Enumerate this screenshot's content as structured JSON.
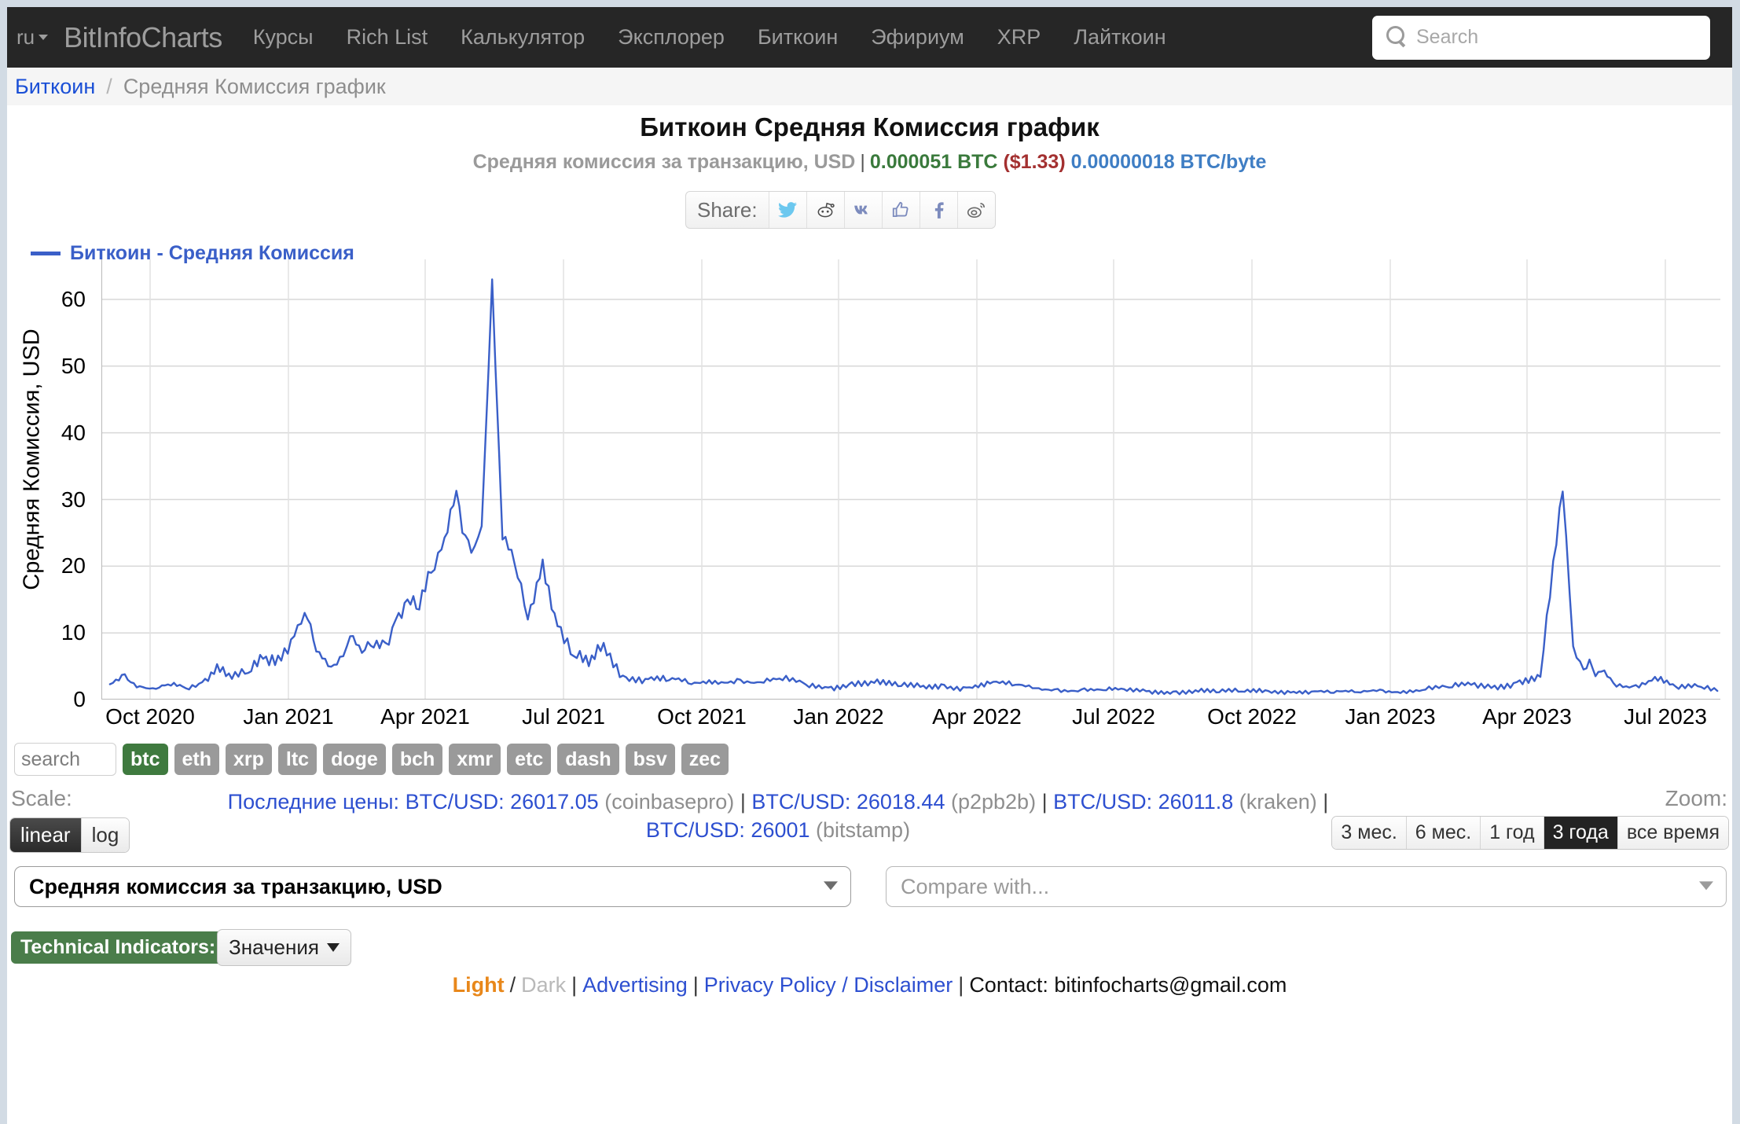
{
  "navbar": {
    "lang": "ru",
    "brand": "BitInfoCharts",
    "links": [
      "Курсы",
      "Rich List",
      "Калькулятор",
      "Эксплорер",
      "Биткоин",
      "Эфириум",
      "XRP",
      "Лайткоин"
    ],
    "search_placeholder": "Search",
    "search_value": "",
    "search_icon": "search-icon",
    "bg": "#262626",
    "text_color": "#9d9d9d"
  },
  "breadcrumb": {
    "root": "Биткоин",
    "separator": "/",
    "current": "Средняя Комиссия график"
  },
  "header": {
    "title": "Биткоин Средняя Комиссия график",
    "subtitle_gray": "Средняя комиссия за транзакцию, USD",
    "subtitle_pipe": "|",
    "subtitle_btc": "0.000051 BTC",
    "subtitle_usd": "($1.33)",
    "subtitle_perbyte": "0.00000018 BTC/byte",
    "color_green": "#3a7a3c",
    "color_red": "#a33030",
    "color_blue": "#3f7ec4"
  },
  "share": {
    "label": "Share:",
    "buttons": [
      "twitter-icon",
      "reddit-icon",
      "vk-icon",
      "thumbs-up-icon",
      "facebook-icon",
      "weibo-icon"
    ]
  },
  "chart_data": {
    "type": "line",
    "title": "Биткоин Средняя Комиссия график",
    "legend": [
      "Биткоин - Средняя Комиссия"
    ],
    "legend_position": "top-left",
    "xlabel": "",
    "ylabel": "Средняя Комиссия, USD",
    "ylim": [
      0,
      66
    ],
    "yticks": [
      0,
      10,
      20,
      30,
      40,
      50,
      60
    ],
    "grid": true,
    "line_color": "#3a5fc8",
    "xticks": [
      "Oct 2020",
      "Jan 2021",
      "Apr 2021",
      "Jul 2021",
      "Oct 2021",
      "Jan 2022",
      "Apr 2022",
      "Jul 2022",
      "Oct 2022",
      "Jan 2023",
      "Apr 2023",
      "Jul 2023"
    ],
    "xlim": [
      "Sep 2020",
      "Aug 2023"
    ],
    "series": [
      {
        "name": "Биткоин - Средняя Комиссия",
        "x": [
          "2020-09-05",
          "2020-09-15",
          "2020-09-25",
          "2020-10-05",
          "2020-10-15",
          "2020-10-25",
          "2020-11-05",
          "2020-11-15",
          "2020-11-25",
          "2020-12-05",
          "2020-12-15",
          "2020-12-25",
          "2021-01-05",
          "2021-01-12",
          "2021-01-20",
          "2021-01-28",
          "2021-02-05",
          "2021-02-12",
          "2021-02-20",
          "2021-02-28",
          "2021-03-05",
          "2021-03-12",
          "2021-03-20",
          "2021-03-28",
          "2021-04-05",
          "2021-04-12",
          "2021-04-18",
          "2021-04-22",
          "2021-04-26",
          "2021-05-01",
          "2021-05-08",
          "2021-05-15",
          "2021-05-22",
          "2021-05-30",
          "2021-06-08",
          "2021-06-18",
          "2021-06-28",
          "2021-07-08",
          "2021-07-18",
          "2021-07-28",
          "2021-08-10",
          "2021-08-25",
          "2021-09-10",
          "2021-09-25",
          "2021-10-10",
          "2021-10-25",
          "2021-11-10",
          "2021-11-25",
          "2021-12-10",
          "2021-12-25",
          "2022-01-10",
          "2022-01-25",
          "2022-02-10",
          "2022-02-25",
          "2022-03-10",
          "2022-03-25",
          "2022-04-10",
          "2022-04-25",
          "2022-05-10",
          "2022-05-25",
          "2022-06-10",
          "2022-06-25",
          "2022-07-10",
          "2022-07-25",
          "2022-08-10",
          "2022-08-25",
          "2022-09-10",
          "2022-09-25",
          "2022-10-10",
          "2022-10-25",
          "2022-11-10",
          "2022-11-25",
          "2022-12-10",
          "2022-12-25",
          "2023-01-10",
          "2023-01-25",
          "2023-02-10",
          "2023-02-25",
          "2023-03-10",
          "2023-03-25",
          "2023-04-10",
          "2023-04-25",
          "2023-05-01",
          "2023-05-08",
          "2023-05-12",
          "2023-05-16",
          "2023-05-20",
          "2023-05-28",
          "2023-06-10",
          "2023-06-25",
          "2023-07-10",
          "2023-07-25",
          "2023-08-05"
        ],
        "y": [
          2.3,
          3.8,
          2.0,
          1.6,
          2.1,
          1.7,
          2.6,
          5.3,
          3.1,
          4.0,
          6.1,
          6.6,
          9.5,
          13.0,
          7.2,
          5.0,
          6.4,
          9.5,
          7.0,
          7.8,
          8.5,
          12.0,
          15.0,
          13.5,
          19.0,
          22.5,
          28.5,
          31.3,
          25.0,
          22.0,
          26.0,
          63.0,
          24.0,
          20.5,
          12.0,
          21.0,
          11.0,
          6.5,
          5.0,
          8.5,
          3.6,
          3.1,
          2.9,
          2.3,
          2.8,
          3.1,
          2.6,
          2.9,
          2.2,
          1.8,
          2.6,
          2.5,
          2.0,
          1.9,
          2.2,
          1.8,
          2.4,
          2.1,
          1.7,
          1.6,
          1.5,
          1.4,
          1.3,
          1.3,
          1.2,
          1.4,
          1.1,
          1.2,
          1.4,
          1.3,
          1.2,
          1.0,
          1.1,
          1.5,
          1.3,
          1.5,
          1.8,
          2.2,
          2.1,
          2.6,
          3.4,
          31.2,
          8.0,
          4.5,
          6.0,
          3.5,
          4.2,
          2.5,
          2.0,
          3.4,
          1.6,
          1.9,
          1.3
        ]
      }
    ],
    "peaks": [
      {
        "label": "Apr 2021 peak",
        "value": 63.0
      },
      {
        "label": "Apr 2023 peak",
        "value": 31.2
      }
    ]
  },
  "coin_row": {
    "search_placeholder": "search",
    "search_value": "",
    "tags": [
      {
        "label": "btc",
        "active": true
      },
      {
        "label": "eth",
        "active": false
      },
      {
        "label": "xrp",
        "active": false
      },
      {
        "label": "ltc",
        "active": false
      },
      {
        "label": "doge",
        "active": false
      },
      {
        "label": "bch",
        "active": false
      },
      {
        "label": "xmr",
        "active": false
      },
      {
        "label": "etc",
        "active": false
      },
      {
        "label": "dash",
        "active": false
      },
      {
        "label": "bsv",
        "active": false
      },
      {
        "label": "zec",
        "active": false
      }
    ],
    "active_color": "#3f7a3f",
    "inactive_color": "#9a9a9a"
  },
  "scale": {
    "label": "Scale:",
    "options": [
      {
        "label": "linear",
        "active": true
      },
      {
        "label": "log",
        "active": false
      }
    ]
  },
  "zoom": {
    "label": "Zoom:",
    "options": [
      {
        "label": "3 мес.",
        "active": false
      },
      {
        "label": "6 мес.",
        "active": false
      },
      {
        "label": "1 год",
        "active": false
      },
      {
        "label": "3 года",
        "active": true
      },
      {
        "label": "все время",
        "active": false
      }
    ]
  },
  "prices": {
    "label": "Последние цены:",
    "items": [
      {
        "pair": "BTC/USD: 26017.05",
        "exchange": "(coinbasepro)"
      },
      {
        "pair": "BTC/USD: 26018.44",
        "exchange": "(p2pb2b)"
      },
      {
        "pair": "BTC/USD: 26011.8",
        "exchange": "(kraken)"
      },
      {
        "pair": "BTC/USD: 26001",
        "exchange": "(bitstamp)"
      }
    ]
  },
  "selects": {
    "metric_value": "Средняя комиссия за транзакцию, USD",
    "compare_placeholder": "Compare with..."
  },
  "indicators": {
    "badge": "Technical Indicators:",
    "button": "Значения"
  },
  "footer": {
    "light": "Light",
    "slash": "/",
    "dark": "Dark",
    "advertising": "Advertising",
    "privacy": "Privacy Policy / Disclaimer",
    "contact": "Contact: bitinfocharts@gmail.com",
    "pipe": "|"
  }
}
